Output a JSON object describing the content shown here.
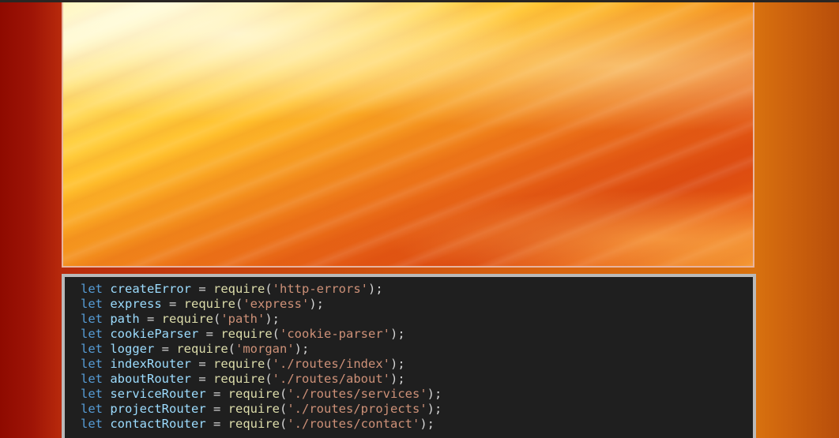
{
  "colors": {
    "keyword": "#569cd6",
    "identifier": "#9cdcfe",
    "function": "#dcdcaa",
    "string": "#ce9178",
    "code_background": "#1f1f1f"
  },
  "hero": {
    "image": "abstract-orange-light-streaks"
  },
  "code": {
    "lines": [
      {
        "keyword": "let",
        "name": "createError",
        "op": " = ",
        "fn": "require",
        "open": "(",
        "arg": "'http-errors'",
        "close": ");"
      },
      {
        "keyword": "let",
        "name": "express",
        "op": " = ",
        "fn": "require",
        "open": "(",
        "arg": "'express'",
        "close": ");"
      },
      {
        "keyword": "let",
        "name": "path",
        "op": " = ",
        "fn": "require",
        "open": "(",
        "arg": "'path'",
        "close": ");"
      },
      {
        "keyword": "let",
        "name": "cookieParser",
        "op": " = ",
        "fn": "require",
        "open": "(",
        "arg": "'cookie-parser'",
        "close": ");"
      },
      {
        "keyword": "let",
        "name": "logger",
        "op": " = ",
        "fn": "require",
        "open": "(",
        "arg": "'morgan'",
        "close": ");"
      },
      {
        "keyword": "let",
        "name": "indexRouter",
        "op": " = ",
        "fn": "require",
        "open": "(",
        "arg": "'./routes/index'",
        "close": ");"
      },
      {
        "keyword": "let",
        "name": "aboutRouter",
        "op": " = ",
        "fn": "require",
        "open": "(",
        "arg": "'./routes/about'",
        "close": ");"
      },
      {
        "keyword": "let",
        "name": "serviceRouter",
        "op": " = ",
        "fn": "require",
        "open": "(",
        "arg": "'./routes/services'",
        "close": ");"
      },
      {
        "keyword": "let",
        "name": "projectRouter",
        "op": " = ",
        "fn": "require",
        "open": "(",
        "arg": "'./routes/projects'",
        "close": ");"
      },
      {
        "keyword": "let",
        "name": "contactRouter",
        "op": " = ",
        "fn": "require",
        "open": "(",
        "arg": "'./routes/contact'",
        "close": ");"
      }
    ]
  }
}
